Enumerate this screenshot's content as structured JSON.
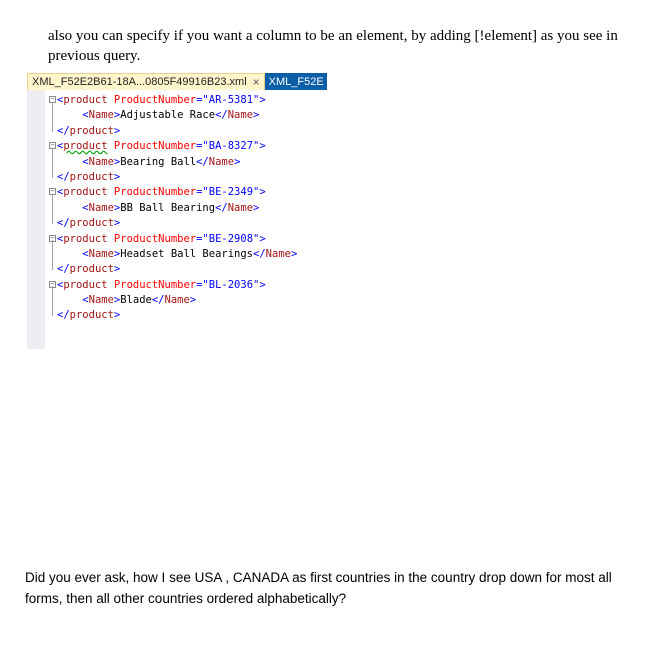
{
  "intro_text": "also you can specify if you want a column to be an element, by adding [!element] as you see in previous query.",
  "editor": {
    "tab_active_label": "XML_F52E2B61-18A...0805F49916B23.xml",
    "tab_close_glyph": "×",
    "tab_inactive_label": "XML_F52E",
    "lines": [
      {
        "kind": "open",
        "tag": "product",
        "attr": "ProductNumber",
        "value": "AR-5381"
      },
      {
        "kind": "child",
        "tag": "Name",
        "text": "Adjustable Race"
      },
      {
        "kind": "close",
        "tag": "product"
      },
      {
        "kind": "open",
        "tag": "product",
        "attr": "ProductNumber",
        "value": "BA-8327"
      },
      {
        "kind": "child",
        "tag": "Name",
        "text": "Bearing Ball"
      },
      {
        "kind": "close",
        "tag": "product"
      },
      {
        "kind": "open",
        "tag": "product",
        "attr": "ProductNumber",
        "value": "BE-2349"
      },
      {
        "kind": "child",
        "tag": "Name",
        "text": "BB Ball Bearing"
      },
      {
        "kind": "close",
        "tag": "product"
      },
      {
        "kind": "open",
        "tag": "product",
        "attr": "ProductNumber",
        "value": "BE-2908"
      },
      {
        "kind": "child",
        "tag": "Name",
        "text": "Headset Ball Bearings"
      },
      {
        "kind": "close",
        "tag": "product"
      },
      {
        "kind": "open",
        "tag": "product",
        "attr": "ProductNumber",
        "value": "BL-2036"
      },
      {
        "kind": "child",
        "tag": "Name",
        "text": "Blade"
      },
      {
        "kind": "close",
        "tag": "product"
      }
    ]
  },
  "question_text": "Did you ever ask, how I see  USA , CANADA as first countries in the country drop down for most all forms, then all other countries ordered alphabetically?"
}
